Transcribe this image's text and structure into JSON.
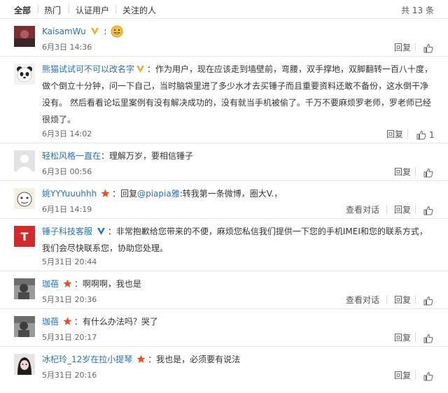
{
  "tabs": {
    "all": "全部",
    "hot": "热门",
    "verified": "认证用户",
    "following": "关注的人"
  },
  "total": "共 13 条",
  "colors": {
    "link": "#2a6fb8",
    "vip": "#f5a623",
    "star": "#e8502d",
    "brand": "#d32b2b"
  },
  "comments": [
    {
      "user": "KaisamWu",
      "text": "",
      "emoji": "grinning-emoji",
      "time": "6月3日 14:36",
      "reply": "回复",
      "likes": ""
    },
    {
      "user": "熊猫试试可不可以改名字",
      "text": "：作为用户，现在应该走到墙壁前，弯腰，双手撑地，双脚翻转一百八十度，做个倒立十分钟，问一下自己，当时脑袋里进了多少水才去买锤子而且重要资料还敢不备份，这水倒干净没有。 然后看看论坛里案例有没有解决成功的，没有就当手机被偷了。千万不要麻烦罗老师，罗老师已经很烦了。",
      "time": "6月3日 14:02",
      "reply": "回复",
      "likes": "1"
    },
    {
      "user": "轻松风格一直在",
      "text": "：理解万岁，要相信锤子",
      "time": "6月3日 00:56",
      "reply": "回复",
      "likes": ""
    },
    {
      "user": "姚YYYuuuhhh",
      "pre": "：回复",
      "mention": "@piapia雅",
      "text": ":转我第一条微博，圈大V.，",
      "time": "6月1日 14:19",
      "view": "查看对话",
      "reply": "回复",
      "likes": ""
    },
    {
      "user": "锤子科技客服",
      "text": "：非常抱歉给您带来的不便，麻烦您私信我们提供一下您的手机IMEI和您的联系方式，我们会尽快联系您，协助您处理。",
      "time": "5月31日 20:44",
      "reply": "回复",
      "likes": "",
      "avatar_letter": "T"
    },
    {
      "user": "珈蓓",
      "text": "：啊啊啊，我也是",
      "time": "5月31日 20:36",
      "view": "查看对话",
      "reply": "回复",
      "likes": ""
    },
    {
      "user": "珈蓓",
      "text": "：有什么办法吗？哭了",
      "time": "5月31日 20:17",
      "reply": "回复",
      "likes": ""
    },
    {
      "user": "冰杞玲_12岁在拉小提琴",
      "text": "：我也是，必须要有说法",
      "time": "5月31日 20:16",
      "reply": "回复",
      "likes": ""
    }
  ]
}
